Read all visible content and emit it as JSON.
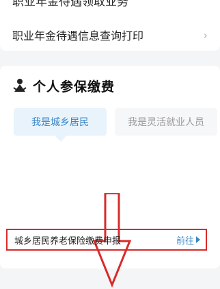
{
  "top_list": {
    "cutoff_text": "职业年金待遇领取业务",
    "item_label": "职业年金待遇信息查询打印",
    "chevron": "›"
  },
  "section": {
    "icon": "insurance-person-icon",
    "title": "个人参保缴费",
    "tabs": [
      {
        "label": "我是城乡居民",
        "active": true
      },
      {
        "label": "我是灵活就业人员",
        "active": false
      }
    ]
  },
  "annotation": {
    "arrow_color": "#d92a2a"
  },
  "service": {
    "label": "城乡居民养老保险缴费申报",
    "go_label": "前往"
  },
  "colors": {
    "accent": "#3a86c8",
    "highlight": "#d92a2a"
  }
}
